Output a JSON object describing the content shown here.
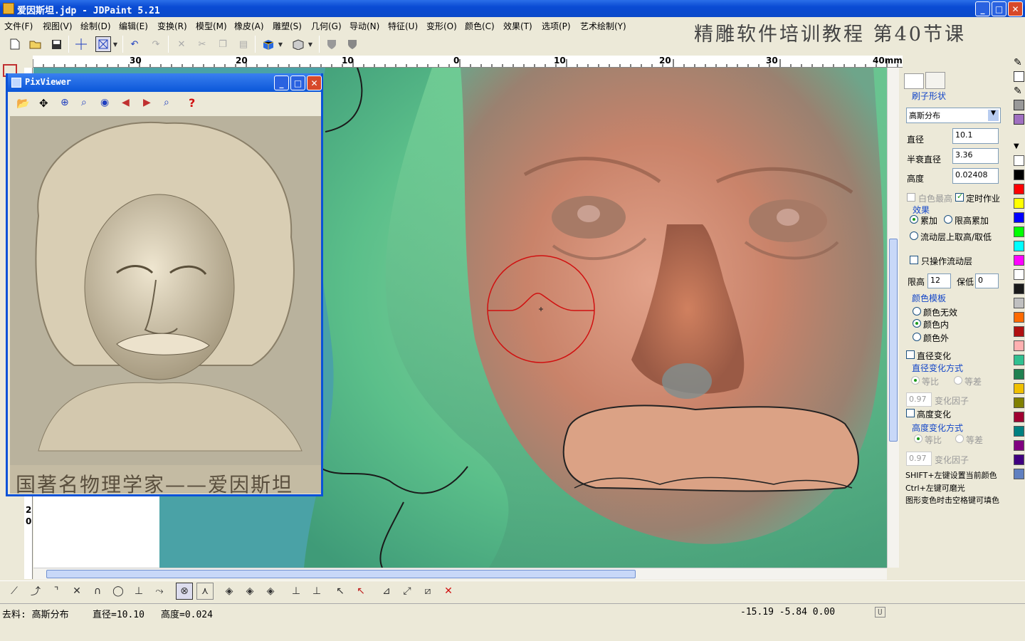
{
  "window": {
    "title": "爱因斯坦.jdp - JDPaint 5.21",
    "min": "_",
    "max": "□",
    "close": "✕"
  },
  "menu": [
    "文件(F)",
    "视图(V)",
    "绘制(D)",
    "编辑(E)",
    "变换(R)",
    "模型(M)",
    "橡皮(A)",
    "雕塑(S)",
    "几何(G)",
    "导动(N)",
    "特征(U)",
    "变形(O)",
    "颜色(C)",
    "效果(T)",
    "选项(P)",
    "艺术绘制(Y)"
  ],
  "banner": "精雕软件培训教程  第40节课",
  "ruler": {
    "labels": [
      "30",
      "20",
      "10",
      "0",
      "10",
      "20",
      "30",
      "40mm"
    ],
    "vlabels": [
      "2",
      "0"
    ]
  },
  "pixviewer": {
    "title": "PixViewer",
    "caption": "国著名物理学家——爱因斯坦",
    "help": "?"
  },
  "panel": {
    "tab_shape": "刷子形状",
    "distribution": "高斯分布",
    "diameter_label": "直径",
    "diameter_value": "10.1",
    "half_decay_label": "半衰直径",
    "half_decay_value": "3.36",
    "height_label": "高度",
    "height_value": "0.02408",
    "white_highest": "白色最高",
    "timed_operation": "定时作业",
    "effect_label": "效果",
    "effect_add": "累加",
    "effect_limit_add": "限高累加",
    "flow_layer_option": "流动层上取高/取低",
    "only_flow_layer": "只操作流动层",
    "limit_high_label": "限高",
    "limit_high_value": "12",
    "keep_low_label": "保低",
    "keep_low_value": "0",
    "color_template_label": "颜色模板",
    "color_none": "颜色无效",
    "color_inside": "颜色内",
    "color_outside": "颜色外",
    "diameter_change": "直径变化",
    "diameter_change_mode": "直径变化方式",
    "ratio": "等比",
    "difference": "等差",
    "factor_value": "0.97",
    "factor_label": "变化因子",
    "height_change": "高度变化",
    "height_change_mode": "高度变化方式",
    "hint1": "SHIFT+左键设置当前颜色",
    "hint2": "Ctrl+左键可磨光",
    "hint3": "图形变色时击空格键可填色"
  },
  "palette": [
    "#ffffff",
    "#000000",
    "#ff0000",
    "#ffff00",
    "#0000ff",
    "#00ff00",
    "#00ffff",
    "#ff00ff",
    "#ffffff",
    "#1a1a1a",
    "#c0c0c0",
    "#ff6a00",
    "#b01010",
    "#ffb0b0",
    "#30c090",
    "#208050",
    "#f0c000",
    "#808000",
    "#a00030",
    "#008080",
    "#800080",
    "#400080",
    "#6080c0"
  ],
  "status": {
    "brush": "去料: 高斯分布",
    "diameter": "直径=10.10",
    "height": "高度=0.024",
    "coords": "-15.19  -5.84  0.00",
    "flag": "U"
  }
}
